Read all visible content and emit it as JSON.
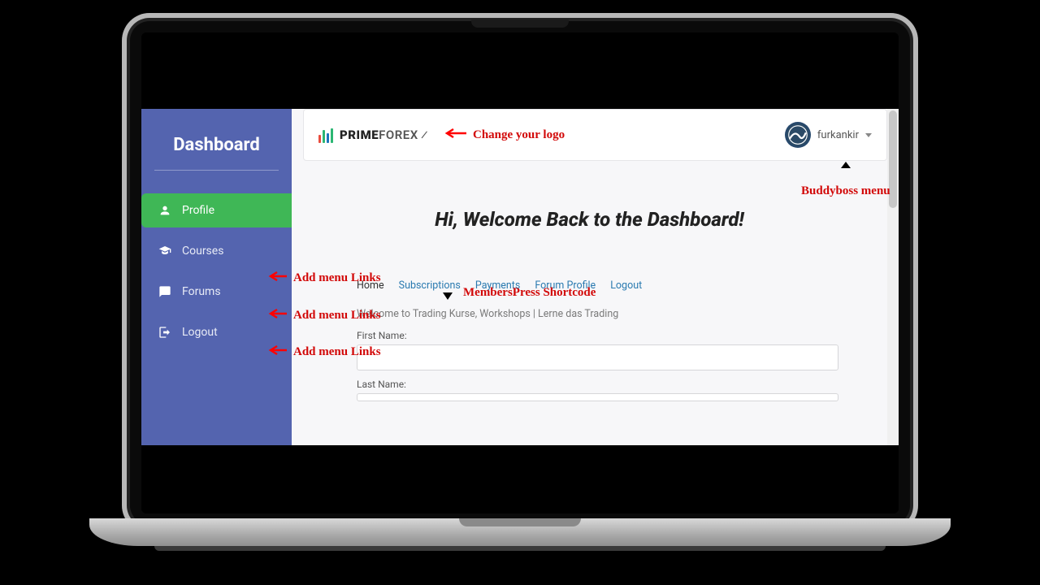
{
  "sidebar": {
    "title": "Dashboard",
    "items": [
      {
        "label": "Profile",
        "icon": "user-icon",
        "active": true
      },
      {
        "label": "Courses",
        "icon": "graduation-icon"
      },
      {
        "label": "Forums",
        "icon": "chat-icon"
      },
      {
        "label": "Logout",
        "icon": "exit-icon"
      }
    ]
  },
  "topbar": {
    "logo_brand": "PRIME",
    "logo_suffix": "FOREX",
    "username": "furkankir"
  },
  "content": {
    "welcome": "Hi, Welcome Back to the Dashboard!",
    "mp_nav": [
      "Home",
      "Subscriptions",
      "Payments",
      "Forum Profile",
      "Logout"
    ],
    "mp_welcome": "Welcome to Trading Kurse, Workshops | Lerne das Trading",
    "first_name_label": "First Name:",
    "last_name_label": "Last Name:"
  },
  "annotations": {
    "change_logo": "Change your logo",
    "buddyboss": "Buddyboss menu",
    "memberspress": "MembersPress Shortcode",
    "add_links_1": "Add menu Links",
    "add_links_2": "Add menu Links",
    "add_links_3": "Add menu Links"
  }
}
